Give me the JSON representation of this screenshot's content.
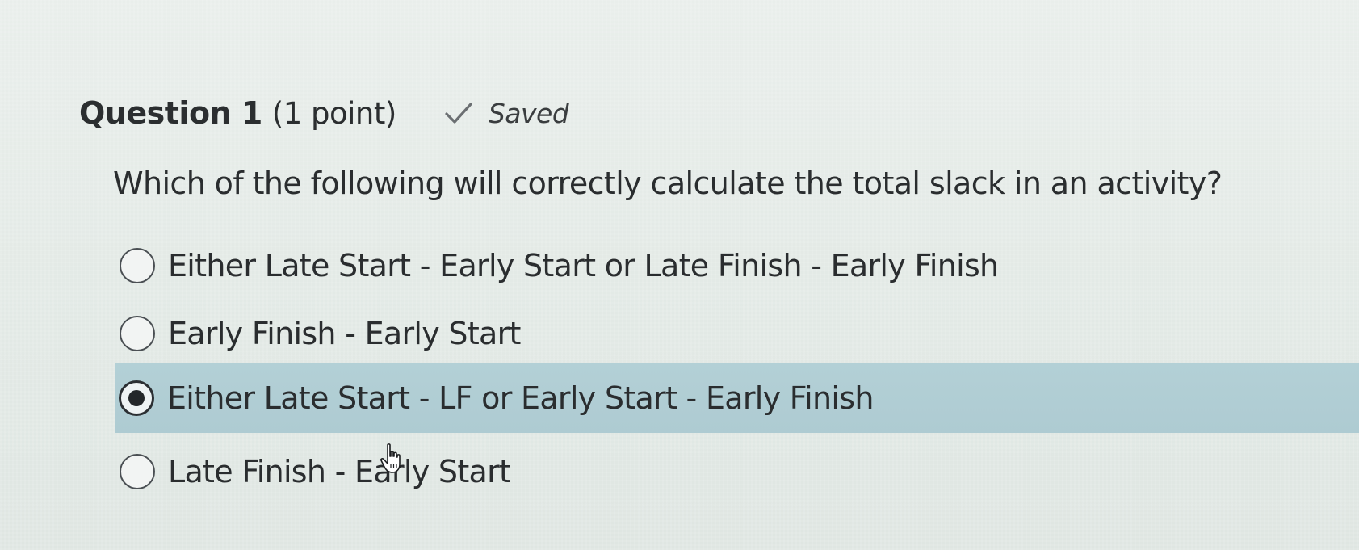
{
  "question": {
    "title": "Question 1",
    "points": "(1 point)",
    "status": "Saved",
    "prompt": "Which of the following will correctly calculate the total slack in an activity?",
    "options": [
      {
        "label": "Either Late Start - Early Start or Late Finish - Early Finish",
        "selected": false
      },
      {
        "label": "Early Finish - Early Start",
        "selected": false
      },
      {
        "label": "Either Late Start - LF or Early Start - Early Finish",
        "selected": true
      },
      {
        "label": "Late Finish - Early Start",
        "selected": false
      }
    ]
  },
  "colors": {
    "selected_row": "#b0cdd4",
    "text": "#2a2d2f",
    "background": "#e4ebe7"
  },
  "icons": {
    "status": "check-icon",
    "cursor": "hand-pointer-icon"
  }
}
